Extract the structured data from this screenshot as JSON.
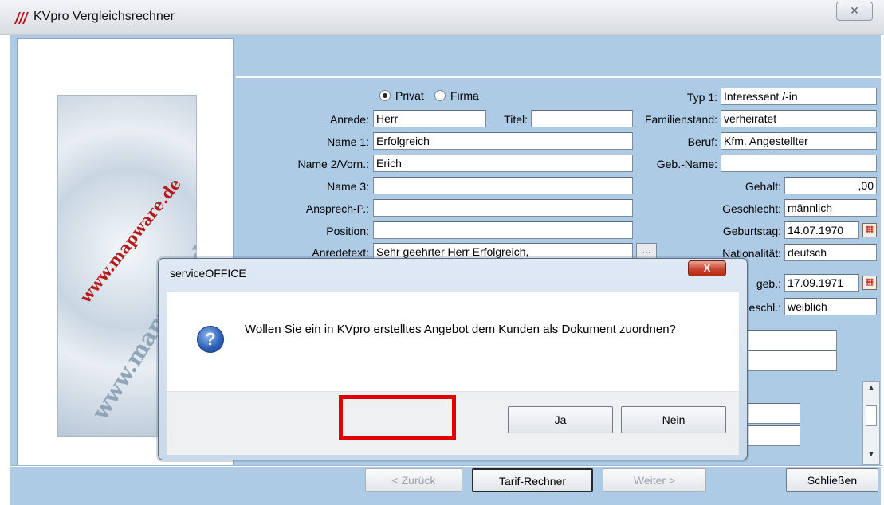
{
  "window": {
    "title": "KVpro Vergleichsrechner",
    "close_glyph": "✕",
    "logo_icon": "mapware-logo-icon",
    "logo_text": "www.mapware.de"
  },
  "form": {
    "radio_privat": "Privat",
    "radio_firma": "Firma",
    "anrede_label": "Anrede:",
    "anrede_value": "Herr",
    "titel_label": "Titel:",
    "titel_value": "",
    "name1_label": "Name 1:",
    "name1_value": "Erfolgreich",
    "name2_label": "Name 2/Vorn.:",
    "name2_value": "Erich",
    "name3_label": "Name 3:",
    "name3_value": "",
    "ansprech_label": "Ansprech-P.:",
    "ansprech_value": "",
    "position_label": "Position:",
    "position_value": "",
    "anredetext_label": "Anredetext:",
    "anredetext_value": "Sehr geehrter Herr Erfolgreich,",
    "dots_label": "...",
    "typ_label": "Typ 1:",
    "typ_value": "Interessent /-in",
    "familienstand_label": "Familienstand:",
    "familienstand_value": "verheiratet",
    "beruf_label": "Beruf:",
    "beruf_value": "Kfm. Angestellter",
    "gebname_label": "Geb.-Name:",
    "gebname_value": "",
    "gehalt_label": "Gehalt:",
    "gehalt_value": ",00",
    "geschlecht_label": "Geschlecht:",
    "geschlecht_value": "männlich",
    "geburtstag_label": "Geburtstag:",
    "geburtstag_value": "14.07.1970",
    "nationalitaet_label": "Nationalität:",
    "nationalitaet_value": "deutsch",
    "partner_geb_label": "geb.:",
    "partner_geb_value": "17.09.1971",
    "partner_geschl_label": "eschl.:",
    "partner_geschl_value": "weiblich"
  },
  "buttons": {
    "zurueck": "< Zurück",
    "tarif": "Tarif-Rechner",
    "weiter": "Weiter >",
    "schliessen": "Schließen"
  },
  "dialog": {
    "title": "serviceOFFICE",
    "close_glyph": "X",
    "icon": "question-icon",
    "icon_glyph": "?",
    "message": "Wollen Sie ein in KVpro erstelltes Angebot dem Kunden als Dokument zuordnen?",
    "yes_label": "Ja",
    "no_label": "Nein"
  },
  "colors": {
    "client_bg": "#aecbe6",
    "highlight": "#e00000",
    "dialog_close": "#c9452f"
  }
}
